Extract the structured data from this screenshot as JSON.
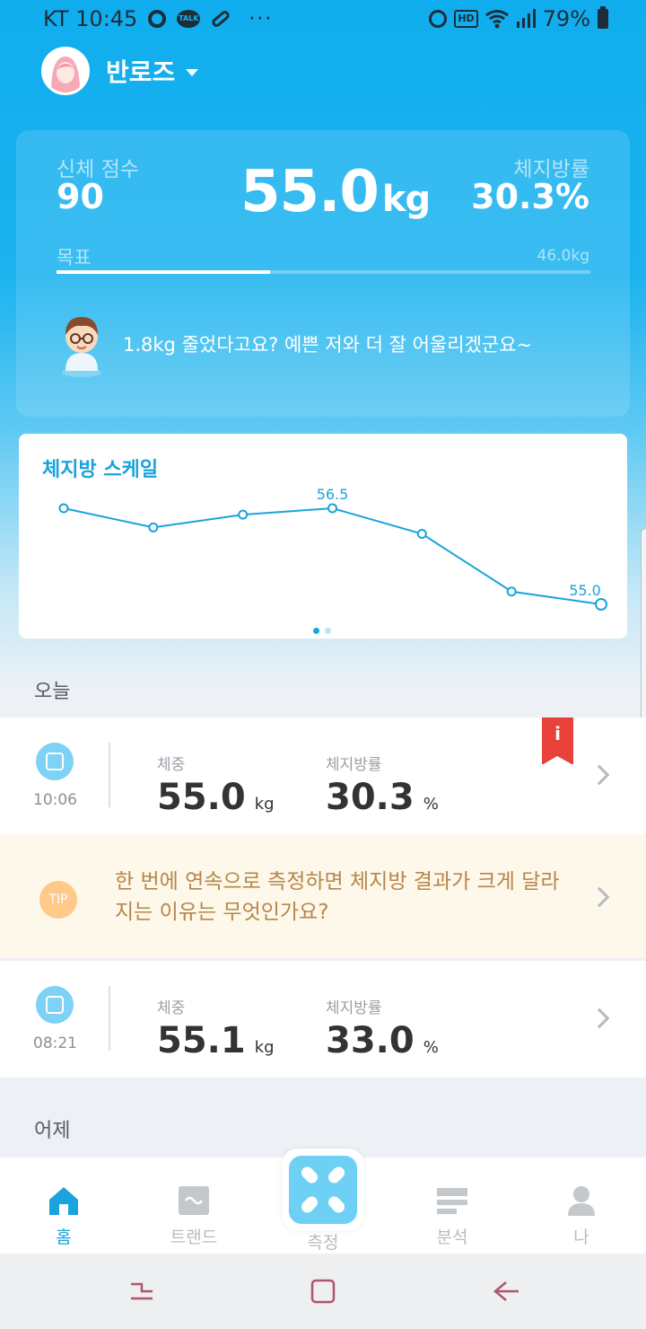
{
  "status_bar": {
    "carrier_time": "KT 10:45",
    "more": "···",
    "hd": "HD",
    "battery": "79%",
    "icons": [
      "camera-dot-icon",
      "kakaotalk-icon",
      "pill-icon",
      "alarm-icon",
      "hd-icon",
      "wifi-icon",
      "signal-icon",
      "battery-icon"
    ],
    "talk_label": "TALK"
  },
  "user": {
    "name": "반로즈"
  },
  "summary": {
    "score_label": "신체 점수",
    "score_value": "90",
    "weight_value": "55.0",
    "weight_unit": "kg",
    "fat_label": "체지방률",
    "fat_value": "30.3%",
    "goal_label": "목표",
    "goal_value": "46.0kg",
    "goal_progress_fraction": 0.4,
    "coach_message": "1.8kg 줄었다고요? 예쁜 저와 더 잘 어울리겠군요~"
  },
  "chart_card": {
    "title": "체지방 스케일",
    "page_count": 2,
    "active_page": 0
  },
  "chart_data": {
    "type": "line",
    "title": "체지방 스케일",
    "series": [
      {
        "values": [
          56.5,
          56.2,
          56.4,
          56.5,
          56.1,
          55.2,
          55.0
        ]
      }
    ],
    "data_labels": [
      "",
      "",
      "",
      "56.5",
      "",
      "",
      "55.0"
    ],
    "ylim": [
      55.0,
      56.5
    ],
    "grid": false,
    "color": "#1aa3dd"
  },
  "today": {
    "section_label": "오늘",
    "records": [
      {
        "time": "10:06",
        "weight_label": "체중",
        "weight_value": "55.0",
        "weight_unit": "kg",
        "fat_label": "체지방률",
        "fat_value": "30.3",
        "fat_unit": "%"
      },
      {
        "time": "08:21",
        "weight_label": "체중",
        "weight_value": "55.1",
        "weight_unit": "kg",
        "fat_label": "체지방률",
        "fat_value": "33.0",
        "fat_unit": "%"
      }
    ],
    "bookmark_text": "i",
    "tip": {
      "badge": "TIP",
      "text": "한 번에 연속으로 측정하면 체지방 결과가 크게 달라지는 이유는 무엇인가요?"
    }
  },
  "yesterday": {
    "section_label": "어제"
  },
  "bottom_nav": {
    "items": [
      {
        "label": "홈",
        "icon": "home-icon"
      },
      {
        "label": "트랜드",
        "icon": "trend-icon"
      },
      {
        "label": "측정",
        "icon": "scale-icon"
      },
      {
        "label": "분석",
        "icon": "analysis-icon"
      },
      {
        "label": "나",
        "icon": "profile-icon"
      }
    ],
    "active_color": "#1aa3dd",
    "inactive_color": "#b7bcc1"
  },
  "system_nav": {
    "icons": [
      "recents-icon",
      "home-button-icon",
      "back-icon"
    ]
  }
}
